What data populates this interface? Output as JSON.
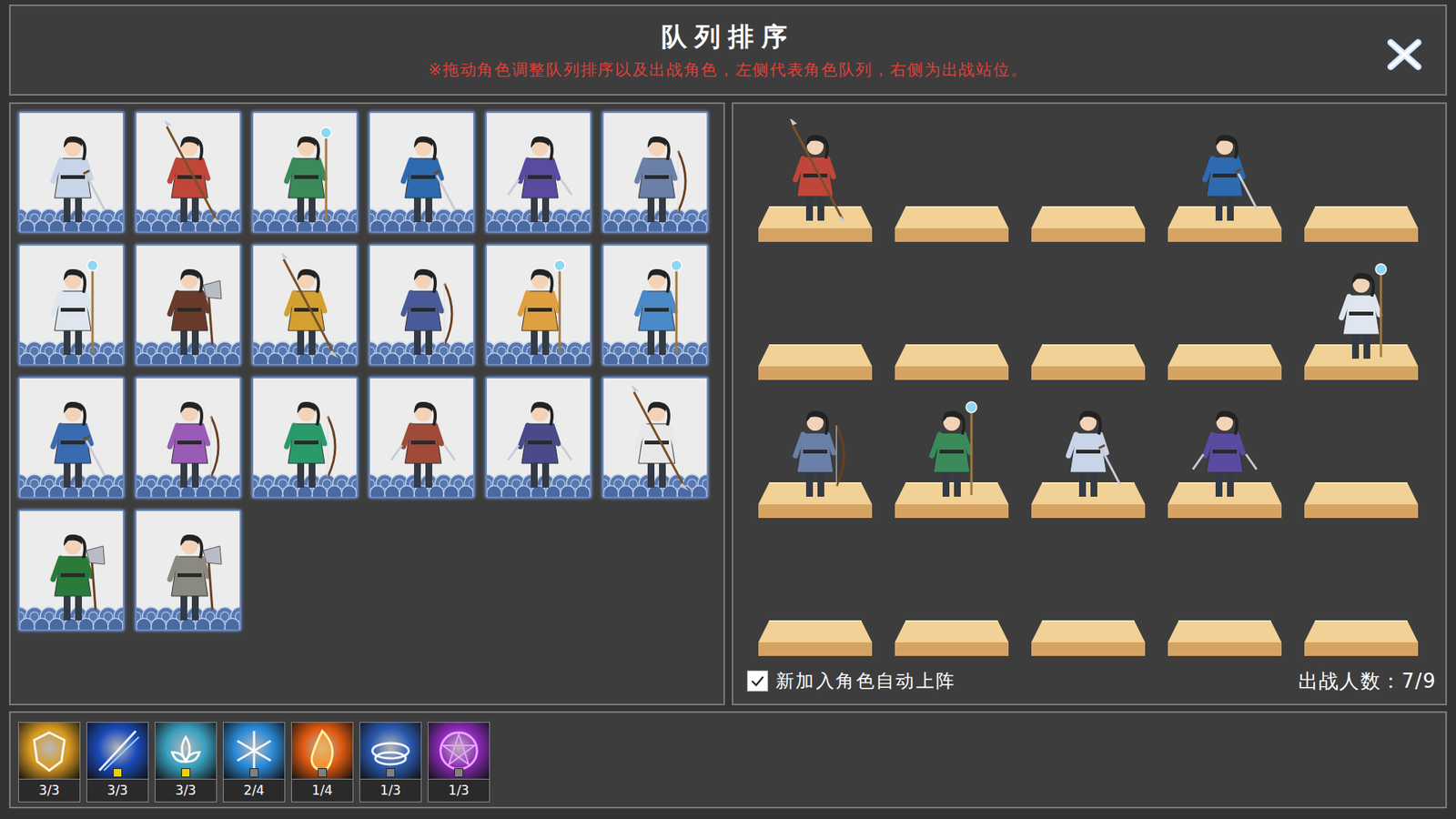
{
  "header": {
    "title": "队列排序",
    "hint": "※拖动角色调整队列排序以及出战角色，左侧代表角色队列，右侧为出战站位。"
  },
  "roster": [
    {
      "color": "#c8d4e8",
      "kind": "sword"
    },
    {
      "color": "#c0463a",
      "kind": "spear"
    },
    {
      "color": "#3a8a5a",
      "kind": "staff"
    },
    {
      "color": "#2d6ab0",
      "kind": "sword"
    },
    {
      "color": "#5a4aa0",
      "kind": "dagger"
    },
    {
      "color": "#6a80a8",
      "kind": "bow"
    },
    {
      "color": "#dfe6f0",
      "kind": "staff"
    },
    {
      "color": "#6a3a2a",
      "kind": "axe"
    },
    {
      "color": "#d4a030",
      "kind": "spear"
    },
    {
      "color": "#4a5a9a",
      "kind": "bow"
    },
    {
      "color": "#e0a040",
      "kind": "staff"
    },
    {
      "color": "#4a8ac8",
      "kind": "staff"
    },
    {
      "color": "#3a6ab0",
      "kind": "sword"
    },
    {
      "color": "#9a5ab8",
      "kind": "bow"
    },
    {
      "color": "#2a9a6a",
      "kind": "bow"
    },
    {
      "color": "#a04a3a",
      "kind": "dagger"
    },
    {
      "color": "#4a4a8a",
      "kind": "dagger"
    },
    {
      "color": "#e8e8e8",
      "kind": "spear"
    },
    {
      "color": "#2a7a3a",
      "kind": "axe"
    },
    {
      "color": "#8a8a80",
      "kind": "axe"
    }
  ],
  "formation": [
    {
      "occupied": true,
      "color": "#c0463a",
      "kind": "spear"
    },
    {
      "occupied": false
    },
    {
      "occupied": false
    },
    {
      "occupied": true,
      "color": "#2d6ab0",
      "kind": "sword"
    },
    {
      "occupied": false
    },
    {
      "occupied": false
    },
    {
      "occupied": false
    },
    {
      "occupied": false
    },
    {
      "occupied": false
    },
    {
      "occupied": true,
      "color": "#dfe6f0",
      "kind": "staff"
    },
    {
      "occupied": true,
      "color": "#6a80a8",
      "kind": "bow"
    },
    {
      "occupied": true,
      "color": "#3a8a5a",
      "kind": "staff"
    },
    {
      "occupied": true,
      "color": "#c8d4e8",
      "kind": "sword"
    },
    {
      "occupied": true,
      "color": "#5a4aa0",
      "kind": "dagger"
    },
    {
      "occupied": false
    },
    {
      "occupied": false
    },
    {
      "occupied": false
    },
    {
      "occupied": false
    },
    {
      "occupied": false
    },
    {
      "occupied": false
    }
  ],
  "auto_deploy": {
    "label": "新加入角色自动上阵",
    "checked": true
  },
  "deploy_count": "出战人数：7/9",
  "skills": [
    {
      "count": "3/3",
      "color": "#d89a20",
      "kind": "shield",
      "marker": false
    },
    {
      "count": "3/3",
      "color": "#1a4ab8",
      "kind": "slash",
      "marker": true,
      "marker_color": "#f0d000"
    },
    {
      "count": "3/3",
      "color": "#3aa0c0",
      "kind": "lotus",
      "marker": true,
      "marker_color": "#f0d000"
    },
    {
      "count": "2/4",
      "color": "#2a8ad8",
      "kind": "snow",
      "marker": true,
      "marker_color": "#808080"
    },
    {
      "count": "1/4",
      "color": "#e05a10",
      "kind": "fire",
      "marker": true,
      "marker_color": "#808080"
    },
    {
      "count": "1/3",
      "color": "#2a5ab0",
      "kind": "ring",
      "marker": true,
      "marker_color": "#808080"
    },
    {
      "count": "1/3",
      "color": "#8a2ab8",
      "kind": "circle",
      "marker": true,
      "marker_color": "#808080"
    }
  ]
}
